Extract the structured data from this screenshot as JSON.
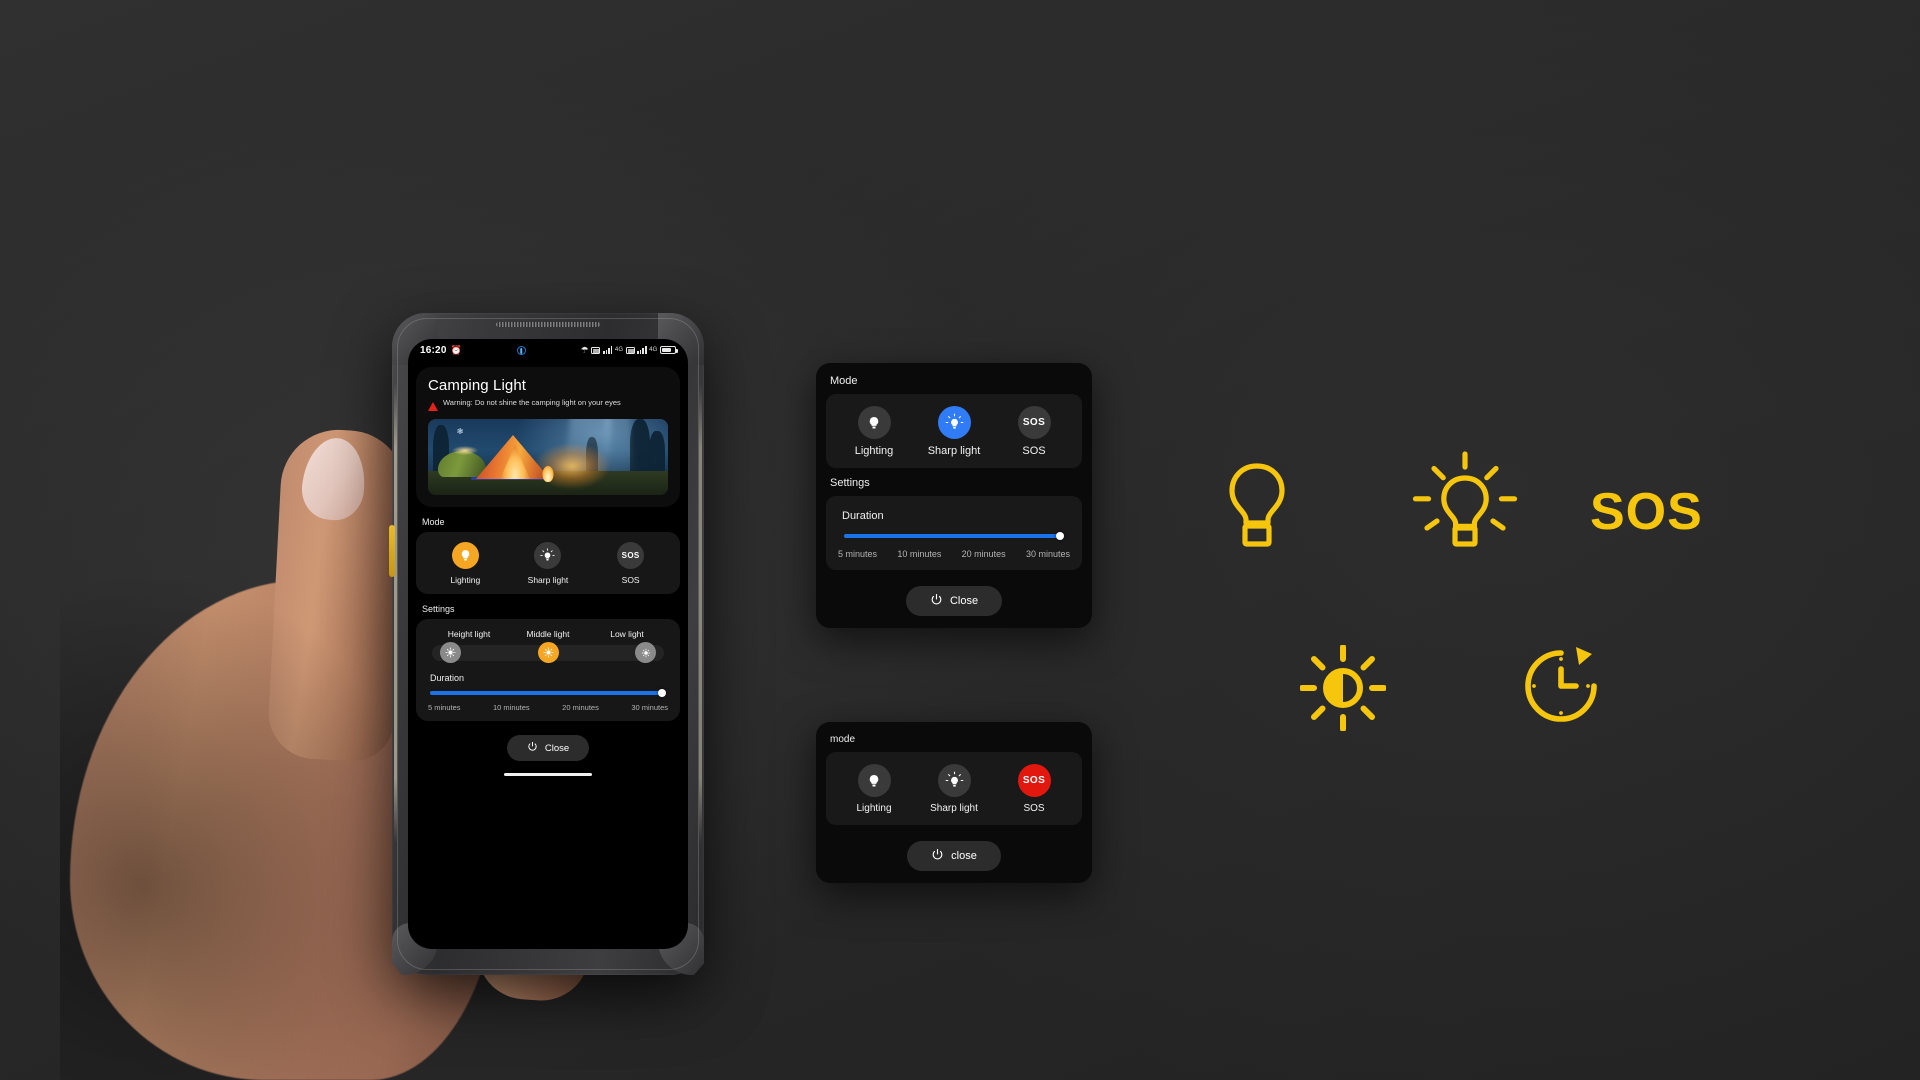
{
  "theme": {
    "background": "#2b2b2b",
    "accent_amber": "#f5a623",
    "accent_blue": "#2f7cf6",
    "accent_red": "#e2180f",
    "slider_blue": "#1a73e8",
    "icon_yellow": "#f6c60d"
  },
  "phone": {
    "status_bar": {
      "time": "16:20",
      "left_icons": [
        "alarm-icon"
      ],
      "center_icon": "camera-punch-hole",
      "right_icons": [
        "wifi-icon",
        "sim1-icon",
        "signal-bars-1",
        "sim2-icon",
        "signal-bars-2",
        "battery-icon"
      ],
      "battery_level": "78"
    },
    "app": {
      "title": "Camping Light",
      "warning": "Warning: Do not shine the camping light on your eyes",
      "hero_image_alt": "campsite-at-night-with-tent-and-campfire",
      "mode": {
        "label": "Mode",
        "options": [
          {
            "icon": "lightbulb-icon",
            "label": "Lighting",
            "selected": true,
            "color": "#f5a623"
          },
          {
            "icon": "sharp-light-icon",
            "label": "Sharp light",
            "selected": false,
            "color": "#3a3a3a"
          },
          {
            "icon": "sos-icon",
            "label": "SOS",
            "glyph": "SOS",
            "selected": false,
            "color": "#3a3a3a"
          }
        ]
      },
      "settings": {
        "label": "Settings",
        "brightness": {
          "levels": [
            "Height light",
            "Middle light",
            "Low light"
          ],
          "selected_index": 1,
          "knob_icon": "brightness-icon"
        },
        "duration": {
          "label": "Duration",
          "ticks": [
            "5 minutes",
            "10 minutes",
            "20 minutes",
            "30 minutes"
          ],
          "value_percent": 100,
          "selected": "30 minutes"
        }
      },
      "close_button": {
        "label": "Close",
        "icon": "power-icon"
      },
      "home_indicator": true
    }
  },
  "panel_a": {
    "mode": {
      "label": "Mode",
      "options": [
        {
          "icon": "lightbulb-icon",
          "label": "Lighting",
          "selected": false,
          "color": "#3a3a3a"
        },
        {
          "icon": "sharp-light-icon",
          "label": "Sharp light",
          "selected": true,
          "color": "#2f7cf6"
        },
        {
          "icon": "sos-icon",
          "label": "SOS",
          "glyph": "SOS",
          "selected": false,
          "color": "#3a3a3a"
        }
      ]
    },
    "settings": {
      "label": "Settings",
      "duration": {
        "label": "Duration",
        "ticks": [
          "5 minutes",
          "10 minutes",
          "20 minutes",
          "30 minutes"
        ],
        "value_percent": 100,
        "selected": "30 minutes"
      }
    },
    "close_button": {
      "label": "Close",
      "icon": "power-icon"
    }
  },
  "panel_b": {
    "mode": {
      "label": "mode",
      "options": [
        {
          "icon": "lightbulb-icon",
          "label": "Lighting",
          "selected": false,
          "color": "#3a3a3a"
        },
        {
          "icon": "sharp-light-icon",
          "label": "Sharp light",
          "selected": false,
          "color": "#3a3a3a"
        },
        {
          "icon": "sos-icon",
          "label": "SOS",
          "glyph": "SOS",
          "selected": true,
          "color": "#e2180f"
        }
      ]
    },
    "close_button": {
      "label": "close",
      "icon": "power-icon"
    }
  },
  "icon_showcase": {
    "items": [
      {
        "name": "lightbulb-outline-icon",
        "caption": ""
      },
      {
        "name": "sharp-light-outline-icon",
        "caption": ""
      },
      {
        "name": "sos-text-icon",
        "glyph": "SOS"
      },
      {
        "name": "brightness-half-icon",
        "caption": ""
      },
      {
        "name": "timer-clock-icon",
        "caption": ""
      }
    ]
  }
}
